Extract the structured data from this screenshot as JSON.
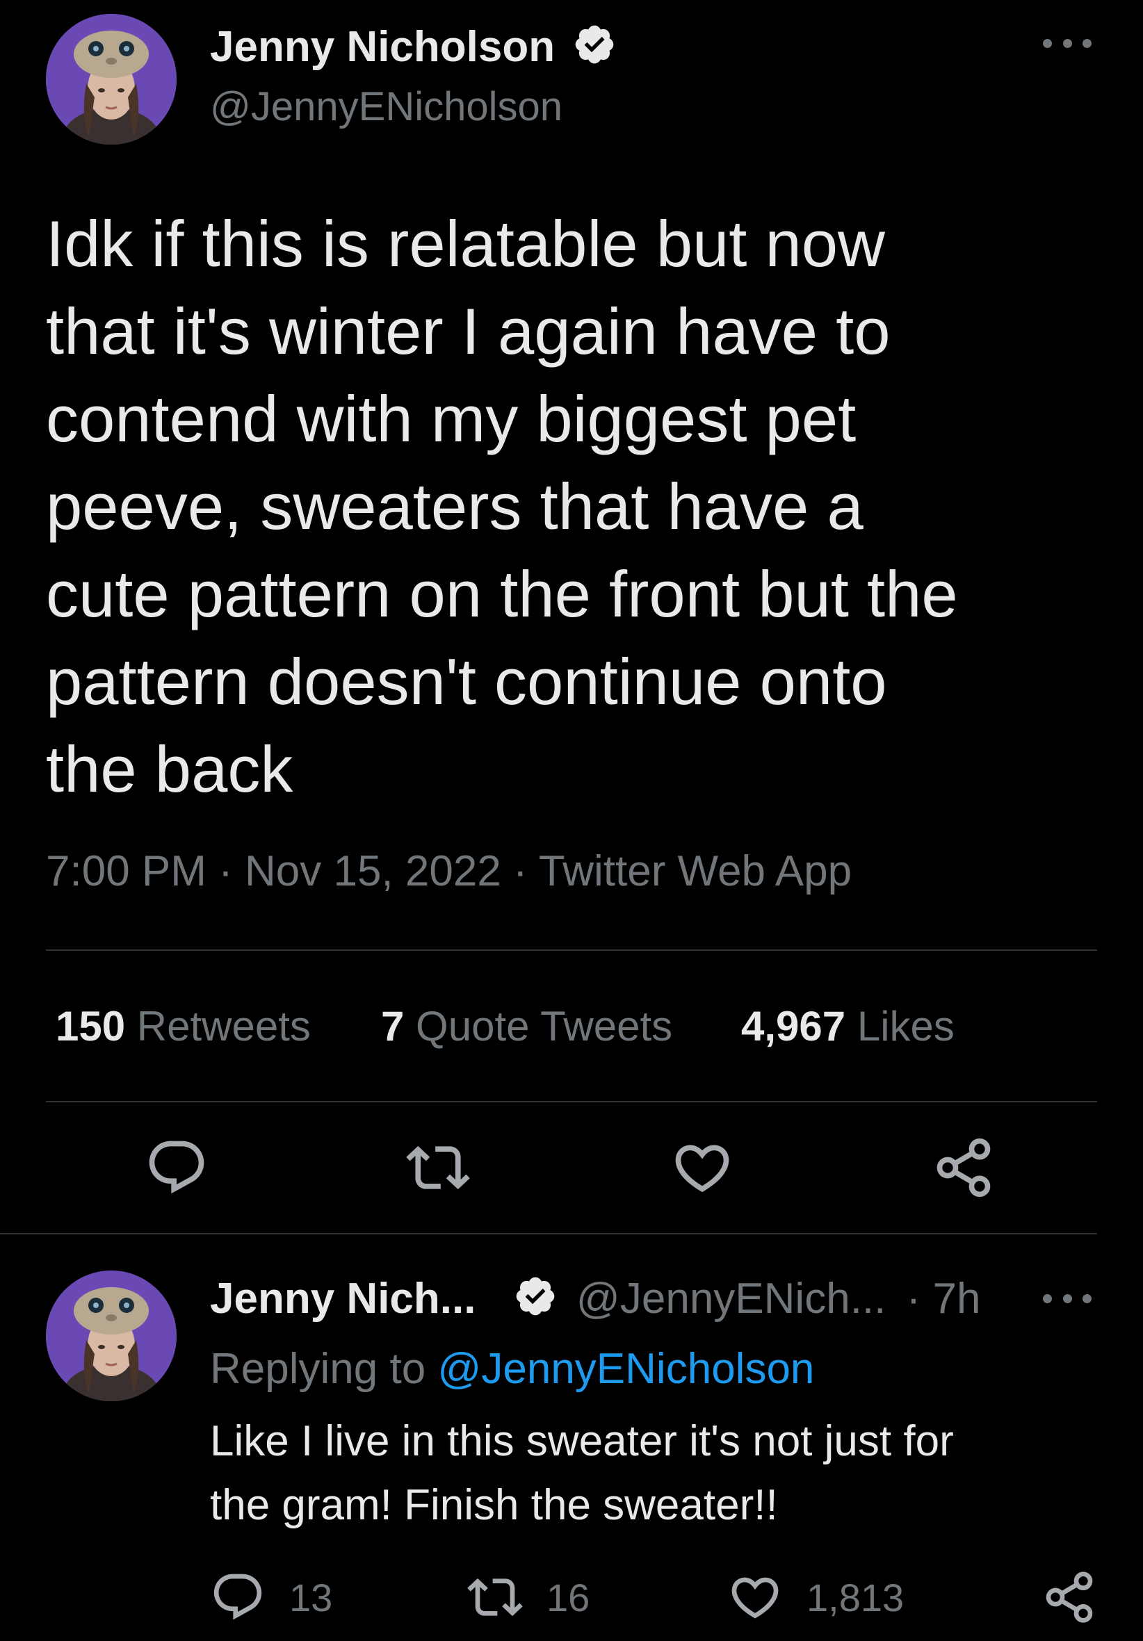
{
  "colors": {
    "background": "#000000",
    "text": "#e7e9ea",
    "secondary": "#71767b",
    "link": "#1d9bf0",
    "divider": "#2f3336"
  },
  "main_tweet": {
    "author_name": "Jenny Nicholson",
    "author_handle": "@JennyENicholson",
    "verified_icon": "verified-badge-icon",
    "more_icon": "more-options-icon",
    "text": "Idk if this is relatable but now\nthat it's winter I again have to\ncontend with my biggest pet\npeeve, sweaters that have a\ncute pattern on the front but the\npattern doesn't continue onto\nthe back",
    "meta": "7:00 PM · Nov 15, 2022 · Twitter Web App",
    "stats": {
      "retweets_count": "150",
      "retweets_label": "Retweets",
      "quotes_count": "7",
      "quotes_label": "Quote Tweets",
      "likes_count": "4,967",
      "likes_label": "Likes"
    },
    "actions": [
      "reply-icon",
      "retweet-icon",
      "like-icon",
      "share-icon"
    ]
  },
  "reply_tweet": {
    "author_name": "Jenny Nich...",
    "author_handle": "@JennyENich...",
    "time": "· 7h",
    "replying_prefix": "Replying to",
    "replying_to": "@JennyENicholson",
    "text": "Like I live in this sweater it's not just for\nthe gram! Finish the sweater!!",
    "reply_count": "13",
    "retweet_count": "16",
    "like_count": "1,813"
  }
}
